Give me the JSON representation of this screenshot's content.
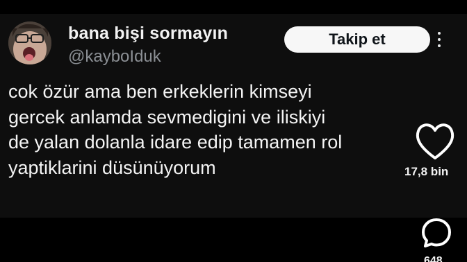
{
  "tweet": {
    "display_name": "bana bişi sormayın",
    "handle": "@kayboIduk",
    "follow_button_label": "Takip et",
    "text": "cok özür ama ben erkeklerin kimseyi\ngercek anlamda sevmedigini ve iliskiyi\nde yalan dolanla idare edip tamamen rol\nyaptiklarini düsünüyorum",
    "avatar_icon": "profile-photo"
  },
  "reel_sidebar": {
    "like_count": "17,8 bin",
    "comment_count": "648",
    "comment_icon": "comment-bubble-icon"
  },
  "colors": {
    "background": "#000000",
    "card": "#0e0e0e",
    "text_primary": "#f4f4f4",
    "text_secondary": "#8b8f94",
    "button_bg": "#f7f7f7",
    "button_text": "#0f1419"
  }
}
